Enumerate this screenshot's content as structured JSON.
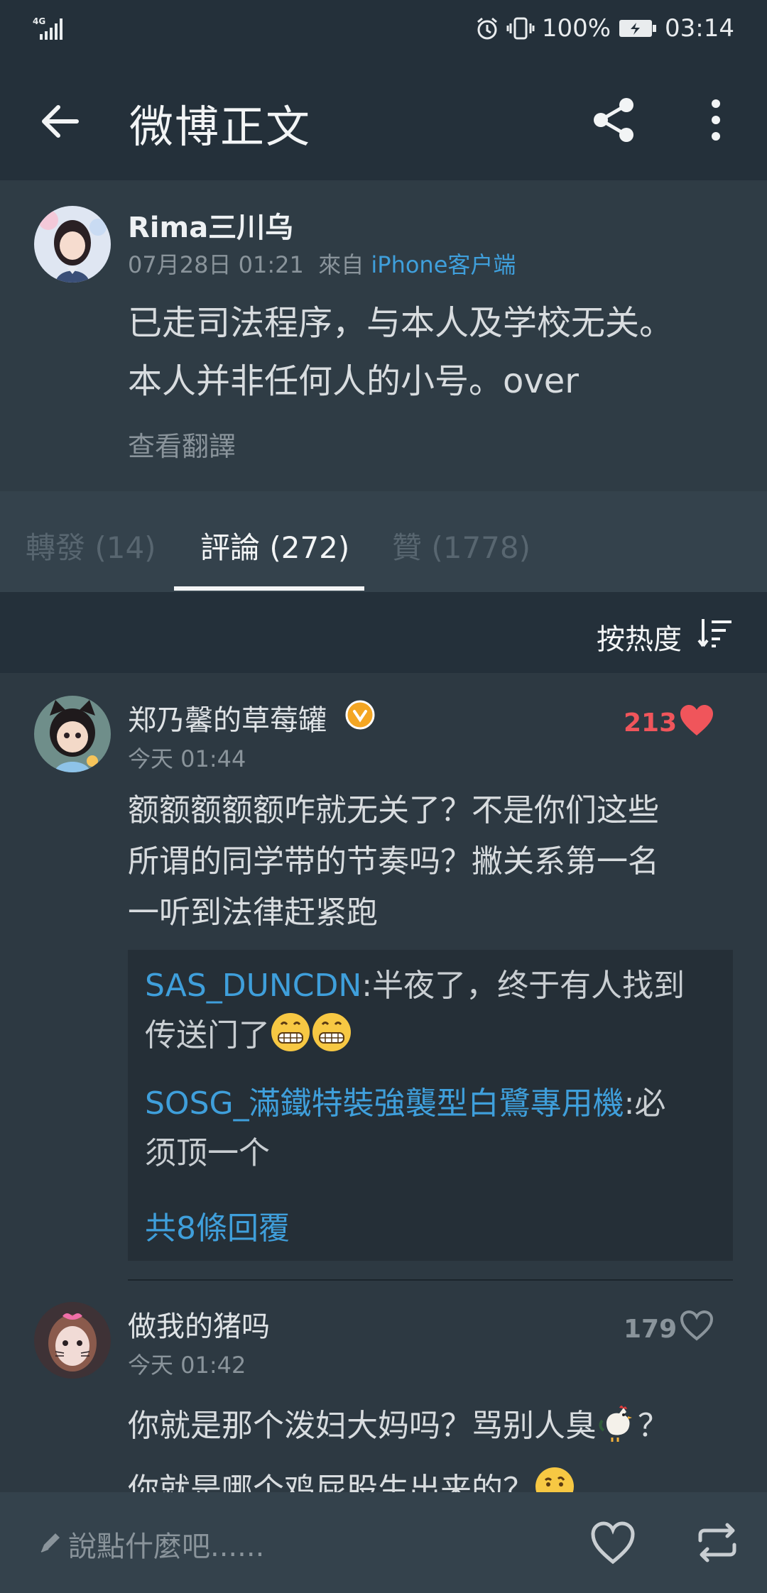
{
  "status": {
    "network": "4G",
    "battery": "100%",
    "time": "03:14"
  },
  "appbar": {
    "title": "微博正文"
  },
  "post": {
    "username": "Rima三川乌",
    "date": "07月28日 01:21",
    "from_label": "來自",
    "source": "iPhone客户端",
    "text_line1": "已走司法程序，与本人及学校无关。",
    "text_line2": "本人并非任何人的小号。over",
    "translate": "查看翻譯"
  },
  "tabs": [
    {
      "label": "轉發 (14)"
    },
    {
      "label": "評論 (272)"
    },
    {
      "label": "贊 (1778)"
    }
  ],
  "sort": {
    "label": "按热度"
  },
  "comments": [
    {
      "username": "郑乃馨的草莓罐",
      "time": "今天 01:44",
      "likes": "213",
      "text_line1": "额额额额额咋就无关了？不是你们这些",
      "text_line2": "所谓的同学带的节奏吗？撇关系第一名",
      "text_line3": "一听到法律赶紧跑",
      "replies": [
        {
          "user": "SAS_DUNCDN",
          "text_a": ":半夜了，终于有人找到",
          "text_b": "传送门了"
        },
        {
          "user": "SOSG_滿鐵特裝強襲型白鷺專用機",
          "text_a": ":必",
          "text_b": "须顶一个"
        }
      ],
      "more_replies": "共8條回覆"
    },
    {
      "username": "做我的猪吗",
      "time": "今天 01:42",
      "likes": "179",
      "text_line1a": "你就是那个泼妇大妈吗？骂别人臭",
      "text_line1b": "？",
      "text_line2": "你就是哪个鸡屁股生出来的？"
    }
  ],
  "bottombar": {
    "placeholder": "說點什麼吧......"
  },
  "colors": {
    "accent": "#3f9fdb",
    "like": "#f0555b",
    "background": "#2d3942"
  }
}
